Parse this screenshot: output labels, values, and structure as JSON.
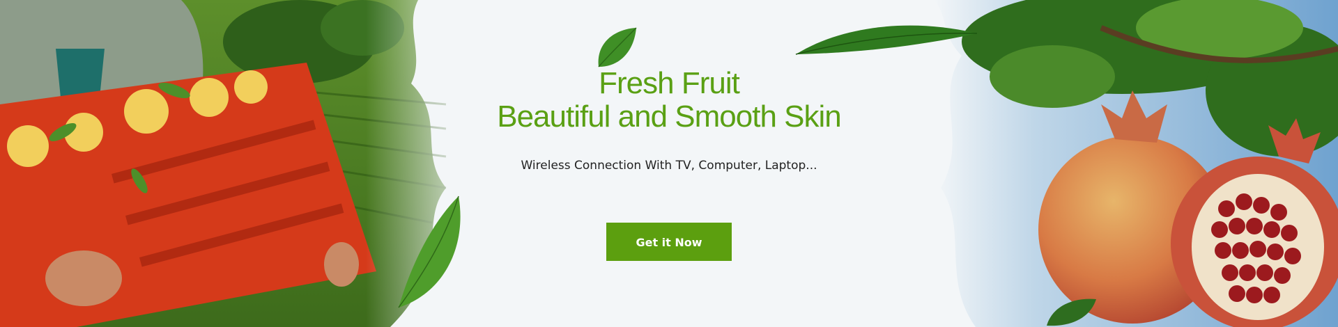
{
  "hero": {
    "title_line1": "Fresh Fruit",
    "title_line2": "Beautiful and Smooth Skin",
    "subtitle": "Wireless Connection With TV, Computer, Laptop...",
    "cta_label": "Get it Now"
  },
  "colors": {
    "brand_green": "#5c9f0f",
    "title_green": "#5aa014",
    "background": "#f3f6f8"
  }
}
